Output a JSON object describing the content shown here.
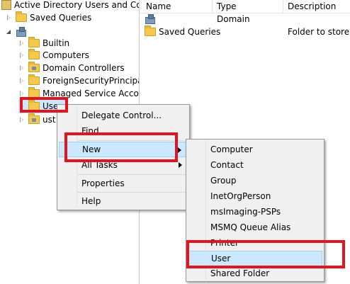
{
  "tree": {
    "root_label": "Active Directory Users and Com",
    "saved_queries": "Saved Queries",
    "domain_label": "",
    "children": [
      "Builtin",
      "Computers",
      "Domain Controllers",
      "ForeignSecurityPrincipals",
      "Managed Service Accour",
      "Use",
      "ust"
    ]
  },
  "list": {
    "columns": [
      "Name",
      "Type",
      "Description"
    ],
    "rows": [
      {
        "name": "",
        "type": "Domain",
        "description": ""
      },
      {
        "name": "Saved Queries",
        "type": "",
        "description": "Folder to store yo"
      }
    ]
  },
  "context_menu": {
    "items": [
      "Delegate Control...",
      "Find...",
      "New",
      "All Tasks",
      "Properties",
      "Help"
    ]
  },
  "new_submenu": {
    "items": [
      "Computer",
      "Contact",
      "Group",
      "InetOrgPerson",
      "msImaging-PSPs",
      "MSMQ Queue Alias",
      "Printer",
      "User",
      "Shared Folder"
    ]
  },
  "colors": {
    "highlight": "#cce8ff",
    "annotation_red": "#e0151f"
  }
}
